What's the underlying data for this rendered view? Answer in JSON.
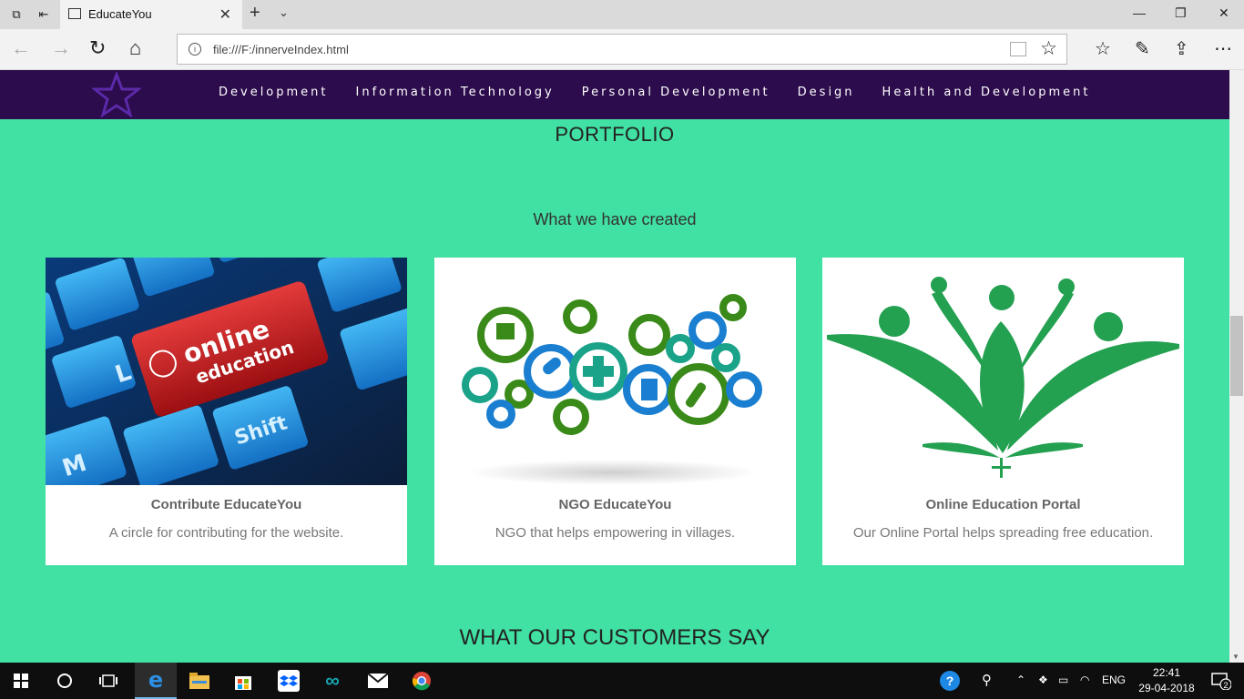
{
  "browser": {
    "tab_title": "EducateYou",
    "url": "file:///F:/innerveIndex.html"
  },
  "site": {
    "nav": [
      "Development",
      "Information Technology",
      "Personal Development",
      "Design",
      "Health and Development"
    ],
    "portfolio_heading": "PORTFOLIO",
    "portfolio_sub": "What we have created",
    "cards": [
      {
        "title": "Contribute EducateYou",
        "desc": "A circle for contributing for the website.",
        "image_text_1": "online",
        "image_text_2": "education"
      },
      {
        "title": "NGO EducateYou",
        "desc": "NGO that helps empowering in villages."
      },
      {
        "title": "Online Education Portal",
        "desc": "Our Online Portal helps spreading free education."
      }
    ],
    "customers_heading": "WHAT OUR CUSTOMERS SAY",
    "colors": {
      "background": "#41e0a3",
      "nav": "#2c0c4c",
      "logo_star": "#5b2aa8"
    }
  },
  "taskbar": {
    "language": "ENG",
    "time": "22:41",
    "date": "29-04-2018",
    "notifications": "2",
    "help_badge": "?"
  }
}
